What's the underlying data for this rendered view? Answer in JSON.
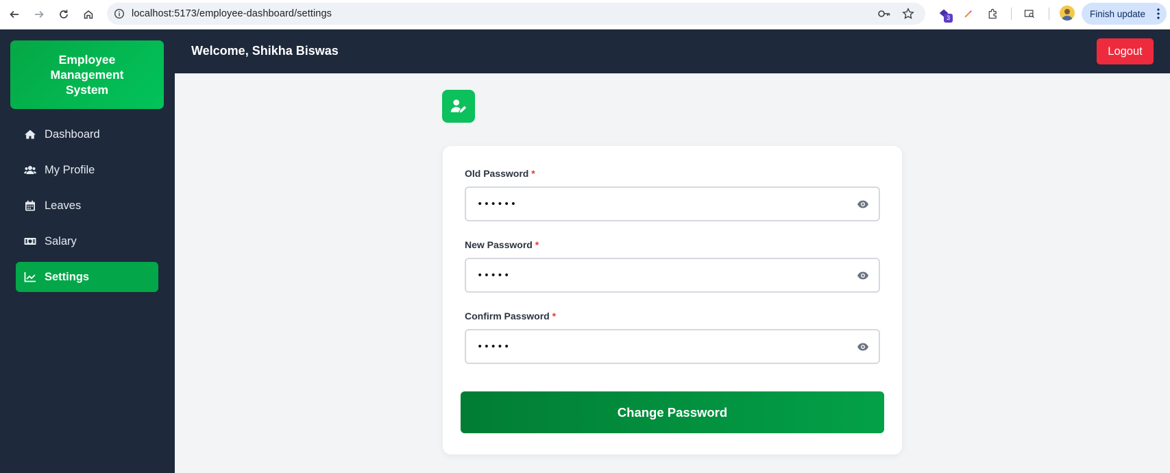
{
  "browser": {
    "url": "localhost:5173/employee-dashboard/settings",
    "extension_badge": "3",
    "finish_update_label": "Finish update"
  },
  "sidebar": {
    "brand": "Employee Management System",
    "items": [
      {
        "label": "Dashboard",
        "icon": "home-icon"
      },
      {
        "label": "My Profile",
        "icon": "users-icon"
      },
      {
        "label": "Leaves",
        "icon": "calendar-icon"
      },
      {
        "label": "Salary",
        "icon": "money-bill-icon"
      },
      {
        "label": "Settings",
        "icon": "chart-line-icon",
        "active": true
      }
    ]
  },
  "header": {
    "welcome": "Welcome, Shikha Biswas",
    "logout_label": "Logout"
  },
  "form": {
    "old_password": {
      "label": "Old Password",
      "required_mark": "*",
      "value": "••••••"
    },
    "new_password": {
      "label": "New Password",
      "required_mark": "*",
      "value": "•••••"
    },
    "confirm_password": {
      "label": "Confirm Password",
      "required_mark": "*",
      "value": "•••••"
    },
    "submit_label": "Change Password"
  },
  "colors": {
    "sidebar_bg": "#1e293b",
    "accent_green": "#03a648",
    "logout_red": "#ee2b3d",
    "page_bg": "#f2f4f5"
  }
}
